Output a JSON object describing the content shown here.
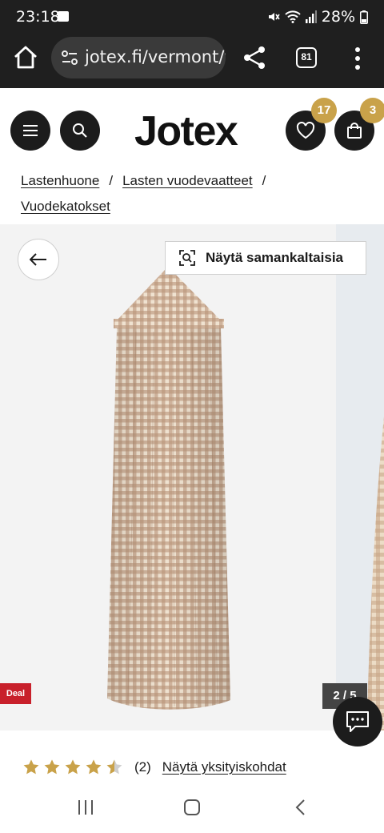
{
  "status_bar": {
    "time": "23:18",
    "battery": "28%",
    "icons": [
      "image-notification-icon",
      "mute-icon",
      "wifi-icon",
      "signal-icon",
      "battery-icon"
    ]
  },
  "browser": {
    "url": "jotex.fi/vermont/v",
    "tab_count": "81",
    "icons": [
      "home-icon",
      "site-settings-icon",
      "share-icon",
      "tabs-icon",
      "more-vert-icon"
    ]
  },
  "header": {
    "logo": "Jotex",
    "wishlist_count": "17",
    "cart_count": "3",
    "icons": [
      "menu-icon",
      "search-icon",
      "heart-icon",
      "bag-icon"
    ]
  },
  "breadcrumb": {
    "items": [
      "Lastenhuone",
      "Lasten vuodevaatteet",
      "Vuodekatokset"
    ],
    "separator": "/"
  },
  "gallery": {
    "similar_label": "Näytä samankaltaisia",
    "deal_label": "Deal",
    "counter": "2 / 5",
    "current_image": 2,
    "total_images": 5,
    "product_pattern_colors": {
      "light": "#efe2d0",
      "dark": "#b9957a"
    }
  },
  "rating": {
    "value": 4.5,
    "max": 5,
    "count": "(2)",
    "details_label": "Näytä yksityiskohdat",
    "star_color": "#c9a24a"
  },
  "colors": {
    "chrome_bg": "#1f1f1f",
    "pill_bg": "#3a3a3a",
    "badge": "#c9a24a",
    "deal": "#c8202b",
    "dark_button": "#1c1c1c"
  }
}
